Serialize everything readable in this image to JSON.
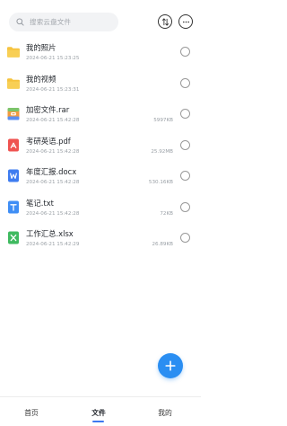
{
  "search": {
    "placeholder": "搜索云盘文件",
    "icon": "search-icon"
  },
  "toolbar": {
    "sort_icon": "sort-icon",
    "more_icon": "more-icon"
  },
  "files": [
    {
      "name": "我的照片",
      "date": "2024-06-21 15:23:25",
      "size": "",
      "type": "folder",
      "icon": "folder-icon",
      "color": "#f6c33f"
    },
    {
      "name": "我的视频",
      "date": "2024-06-21 15:23:31",
      "size": "",
      "type": "folder",
      "icon": "folder-icon",
      "color": "#f6c33f"
    },
    {
      "name": "加密文件.rar",
      "date": "2024-06-21 15:42:28",
      "size": "5997KB",
      "type": "rar",
      "icon": "archive-icon",
      "color": "#f09a3e"
    },
    {
      "name": "考研英语.pdf",
      "date": "2024-06-21 15:42:28",
      "size": "25.92MB",
      "type": "pdf",
      "icon": "pdf-icon",
      "color": "#ef5350"
    },
    {
      "name": "年度汇报.docx",
      "date": "2024-06-21 15:42:28",
      "size": "530.16KB",
      "type": "docx",
      "icon": "word-icon",
      "color": "#3e7cf0"
    },
    {
      "name": "笔记.txt",
      "date": "2024-06-21 15:42:28",
      "size": "72KB",
      "type": "txt",
      "icon": "text-icon",
      "color": "#3f8ef5"
    },
    {
      "name": "工作汇总.xlsx",
      "date": "2024-06-21 15:42:29",
      "size": "26.89KB",
      "type": "xlsx",
      "icon": "excel-icon",
      "color": "#3fba60"
    }
  ],
  "fab": {
    "icon": "plus-icon",
    "color": "#2a8ef2"
  },
  "tabs": [
    {
      "label": "首页",
      "active": false
    },
    {
      "label": "文件",
      "active": true
    },
    {
      "label": "我的",
      "active": false
    }
  ],
  "accent": "#3c78f0"
}
